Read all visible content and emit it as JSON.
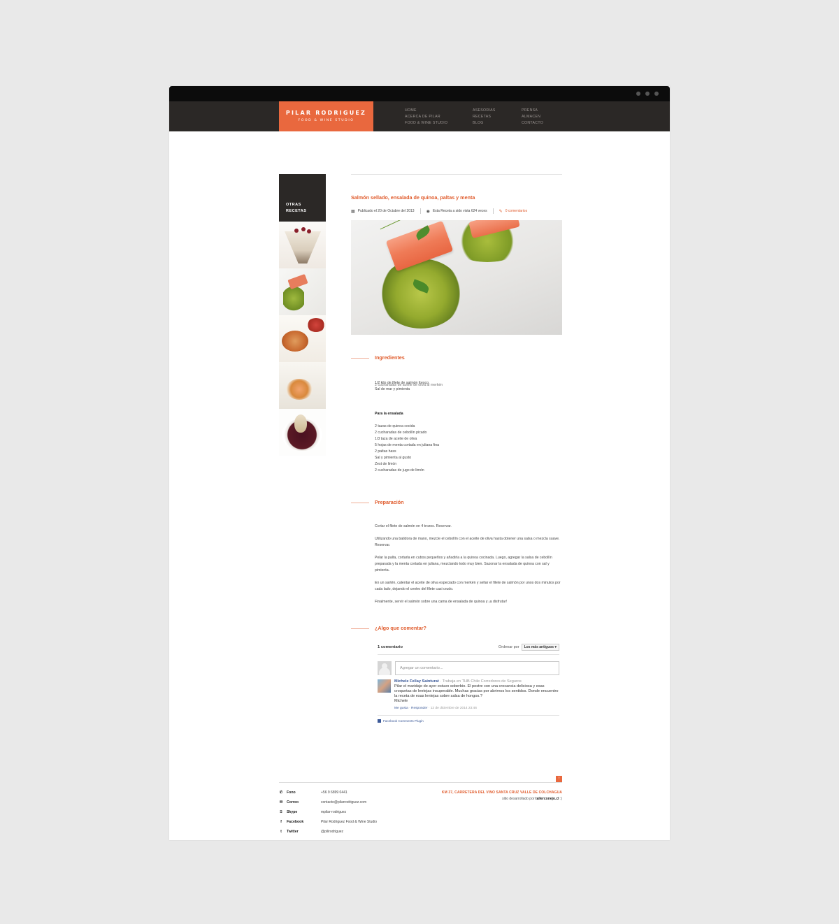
{
  "brand": {
    "name": "PILAR RODRIGUEZ",
    "tagline": "FOOD & WINE STUDIO",
    "accent_color": "#e9683e",
    "dark_color": "#2b2826"
  },
  "nav": {
    "col1": [
      "HOME",
      "ACERCA DE PILAR",
      "FOOD & WINE STUDIO"
    ],
    "col2": [
      "ASESORIAS",
      "RECETAS",
      "BLOG"
    ],
    "col3": [
      "PRENSA",
      "ALMACEN",
      "CONTACTO"
    ]
  },
  "sidebar": {
    "title_line1": "OTRAS",
    "title_line2": "RECETAS",
    "thumbnails": [
      "dessert-glass",
      "salmon-quinoa",
      "crab-cake",
      "shrimp-plate",
      "poached-pear"
    ]
  },
  "post": {
    "title": "Salmón sellado, ensalada de quinoa, paltas y menta",
    "published": "Publicado el 20 de Octubre del 2013",
    "views": "Esta Receta a sido vista 624 veces",
    "comments": "0 comentarios"
  },
  "ingredients": {
    "title": "Ingredientes",
    "line1": "1/2 kilo de filete de salmón fresco",
    "line1_overlap": "2 cucharadas de aceite de oliva al merkén",
    "line2": "Sal de mar y pimienta",
    "salad_title": "Para la ensalada",
    "salad": [
      "2 tazas de quinoa cocida",
      "2 cucharadas de cebollín picado",
      "1/3 taza de aceite de oliva",
      "5 hojas de menta cortada en juliana fina",
      "2 paltas hass",
      "Sal y pimienta al gusto",
      "Zest de limón",
      "2 cucharadas de jugo de limón"
    ]
  },
  "preparation": {
    "title": "Preparación",
    "steps": [
      "Cortar el filete de salmón en 4 trozos. Reservar.",
      "Utilizando una batidora de mano, mezcle el cebollín con el aceite de oliva hasta obtener una salsa o mezcla suave. Reservar.",
      "Pelar la palta, cortarla en cubos pequeños y añadirla a la quinoa cocinada. Luego, agregar la salsa de cebollín preparada y la menta cortada en juliana, mezclando todo muy bien. Sazonar la ensalada de quinoa con sal y pimienta.",
      "En un sartén, calentar el aceite de oliva especiado con merkén y sellar el filete de salmón por unos dos minutos por cada lado, dejando el centro del filete casi crudo.",
      "Finalmente, servir el salmón sobre una cama de ensalada de quinoa y ¡a disfrutar!"
    ]
  },
  "comments_section": {
    "title": "¿Algo que comentar?",
    "count": "1 comentario",
    "sort_label": "Ordenar por",
    "sort_value": "Los más antiguos",
    "input_placeholder": "Agregar un comentario...",
    "comment": {
      "author": "Michele Fellay Sainturat",
      "role": "· Trabaja en THB Chile Corredores de Seguros",
      "body": "Pilar el maridaje de ayer estuvo soberbio. El postre con una crocancia deliciosa y esas croquetas de lentejas insuperable. Muchas gracias por abrirnos los sentidos. Donde encuentro la receta de esas lentejas sobre salsa de hongos.?",
      "signature": "Michele",
      "like": "Me gusta",
      "reply": "Responder",
      "date": "· 12 de diciembre de 2014 23:46"
    },
    "plugin": "Facebook Comments Plugin"
  },
  "footer": {
    "labels": [
      "Fono",
      "Correo",
      "Skype",
      "Facebook",
      "Twitter"
    ],
    "values": [
      "+56 9 6899 0441",
      "contacto@pilarrodriguez.com",
      "mpilar-rodriguez",
      "Pilar Rodriguez Food & Wine Studio",
      "@pilirodriguez"
    ],
    "address": "KM 37, CARRETERA DEL VINO SANTA CRUZ VALLE DE COLCHAGUA",
    "dev_prefix": "sitio desarrollado por",
    "dev_name": "tallerconejo.cl",
    "dev_suffix": ":)"
  }
}
